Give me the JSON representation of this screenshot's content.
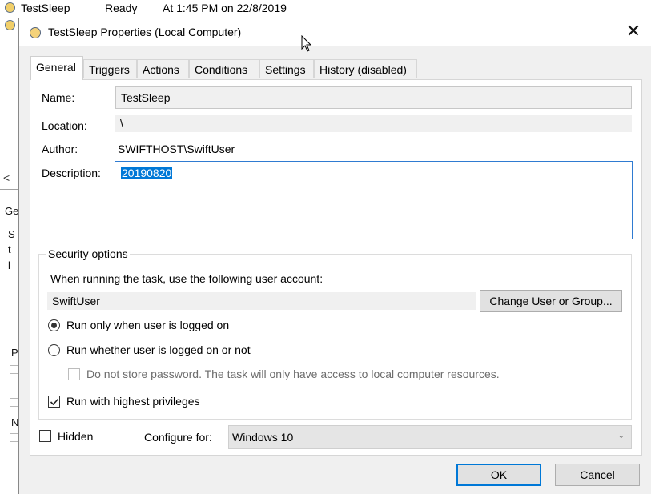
{
  "background_window": {
    "row1": {
      "name": "TestSleep",
      "status": "Ready",
      "trigger": "At 1:45 PM on 22/8/2019"
    },
    "scroll_left_glyph": "<",
    "partial_tab": "Ge",
    "partial_letters": [
      "S",
      "t",
      "l",
      "P",
      "N"
    ]
  },
  "dialog": {
    "title": "TestSleep Properties (Local Computer)",
    "close_glyph": "✕",
    "tabs": [
      {
        "label": "General",
        "active": true
      },
      {
        "label": "Triggers",
        "active": false
      },
      {
        "label": "Actions",
        "active": false
      },
      {
        "label": "Conditions",
        "active": false
      },
      {
        "label": "Settings",
        "active": false
      },
      {
        "label": "History (disabled)",
        "active": false
      }
    ],
    "general": {
      "name_label": "Name:",
      "name_value": "TestSleep",
      "location_label": "Location:",
      "location_value": "\\",
      "author_label": "Author:",
      "author_value": "SWIFTHOST\\SwiftUser",
      "description_label": "Description:",
      "description_value": "20190820"
    },
    "security": {
      "title": "Security options",
      "account_prompt": "When running the task, use the following user account:",
      "account_value": "SwiftUser",
      "change_button": "Change User or Group...",
      "radio_logged_on": "Run only when user is logged on",
      "radio_logged_on_selected": true,
      "radio_whether": "Run whether user is logged on or not",
      "radio_whether_selected": false,
      "no_store_password": "Do not store password.  The task will only have access to local computer resources.",
      "no_store_password_checked": false,
      "highest_privileges": "Run with highest privileges",
      "highest_privileges_checked": true
    },
    "hidden_label": "Hidden",
    "hidden_checked": false,
    "configure_label": "Configure for:",
    "configure_value": "Windows 10",
    "ok_button": "OK",
    "cancel_button": "Cancel"
  },
  "colors": {
    "selection": "#0078d7",
    "dialog_bg": "#f0f0f0",
    "focus_border": "#2f7bd1"
  },
  "icons": [
    "clock-icon",
    "close-icon",
    "mouse-cursor-icon",
    "chevron-down-icon",
    "checkmark-icon"
  ]
}
